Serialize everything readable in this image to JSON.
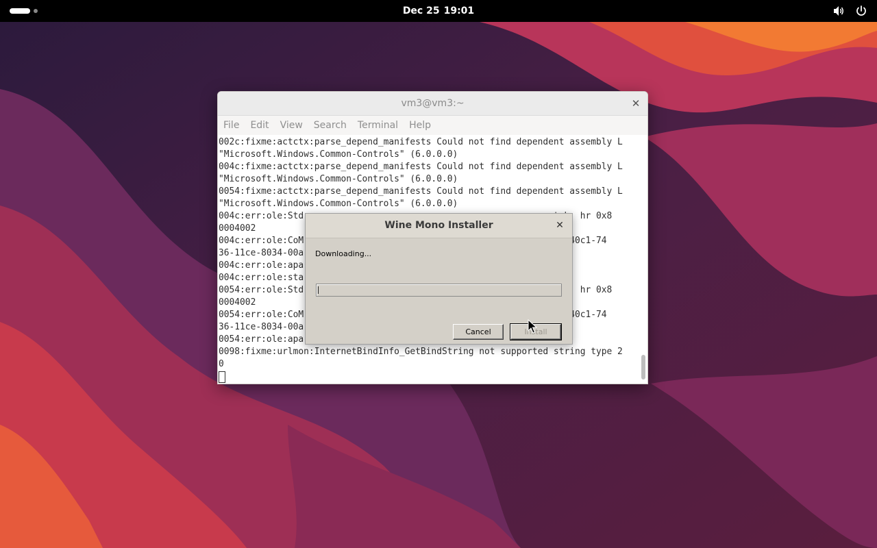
{
  "topbar": {
    "date": "Dec 25",
    "time": "19:01",
    "icons": [
      "activities-indicator",
      "volume-icon",
      "power-icon"
    ]
  },
  "terminal": {
    "title": "vm3@vm3:~",
    "menu": [
      "File",
      "Edit",
      "View",
      "Search",
      "Terminal",
      "Help"
    ],
    "lines": [
      "002c:fixme:actctx:parse_depend_manifests Could not find dependent assembly L",
      "\"Microsoft.Windows.Common-Controls\" (6.0.0.0)",
      "004c:fixme:actctx:parse_depend_manifests Could not find dependent assembly L",
      "\"Microsoft.Windows.Common-Controls\" (6.0.0.0)",
      "0054:fixme:actctx:parse_depend_manifests Could not find dependent assembly L",
      "\"Microsoft.Windows.Common-Controls\" (6.0.0.0)",
      "004c:err:ole:Std                                              stub, hr 0x8",
      "0004002",
      "004c:err:ole:CoM                                              6d5140c1-74",
      "36-11ce-8034-00a",
      "004c:err:ole:apa                                              2",
      "004c:err:ole:sta",
      "0054:err:ole:Std                                              stub, hr 0x8",
      "0004002",
      "0054:err:ole:CoM                                              6d5140c1-74",
      "36-11ce-8034-00a",
      "0054:err:ole:apa                                              2",
      "0098:fixme:urlmon:InternetBindInfo_GetBindString not supported string type 2",
      "0"
    ]
  },
  "wine_dialog": {
    "title": "Wine Mono Installer",
    "status": "Downloading...",
    "progress": 0,
    "cancel_label": "Cancel",
    "install_label": "Install",
    "install_enabled": false
  },
  "colors": {
    "topbar": "#000000",
    "dialog_bg": "#d4d0c8",
    "terminal_menu_text": "#8e8e8e"
  }
}
